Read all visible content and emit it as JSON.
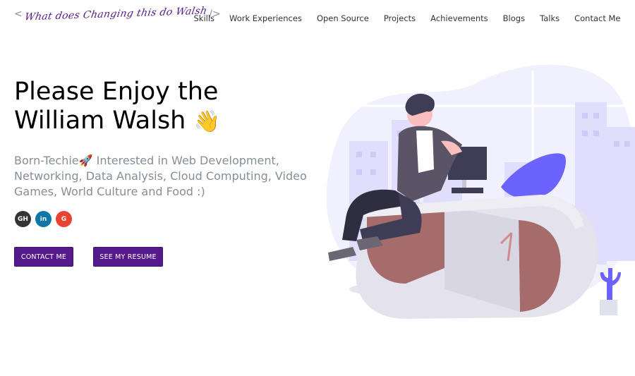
{
  "header": {
    "logo_open": "<",
    "logo_signature": "What does Changing this do Walsh",
    "logo_close": "/>",
    "nav": [
      "Skills",
      "Work Experiences",
      "Open Source",
      "Projects",
      "Achievements",
      "Blogs",
      "Talks",
      "Contact Me"
    ]
  },
  "hero": {
    "title_line1": "Please Enjoy the",
    "title_line2": "William Walsh",
    "wave_emoji": "👋",
    "subtitle": "Born-Techie🚀 Interested in Web Development, Networking, Data Analysis, Cloud Computing, Video Games, World Culture and Food :)",
    "socials": [
      {
        "name": "github",
        "glyph": "GH"
      },
      {
        "name": "linkedin",
        "glyph": "in"
      },
      {
        "name": "google",
        "glyph": "G"
      }
    ],
    "contact_button": "CONTACT ME",
    "resume_button": "SEE MY RESUME"
  },
  "colors": {
    "accent": "#55198b",
    "blob": "#f0f0ff",
    "desk": "#e4e2ec",
    "desk_body": "#a66b6b",
    "chair": "#6c63ff"
  }
}
